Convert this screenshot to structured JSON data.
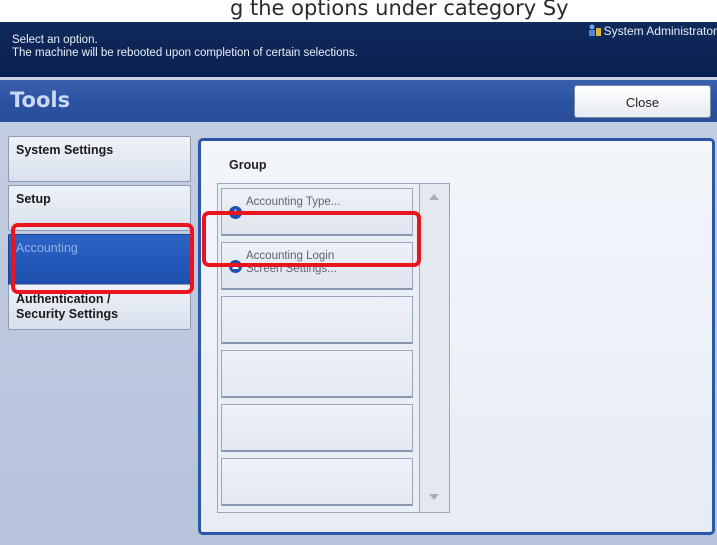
{
  "banner": {
    "text": "g  the  options  under  category  Sy"
  },
  "header": {
    "message_line1": "Select an option.",
    "message_line2": "The machine will be rebooted upon completion of certain selections.",
    "user": "System Administrator",
    "user_icon": "user-admin-icon"
  },
  "titlebar": {
    "title": "Tools",
    "close_label": "Close"
  },
  "tabs": [
    {
      "label": "System Settings",
      "selected": false
    },
    {
      "label": "Setup",
      "selected": false
    },
    {
      "label": "Accounting",
      "selected": true
    },
    {
      "label_line1": "Authentication /",
      "label_line2": "Security Settings",
      "selected": false
    }
  ],
  "group": {
    "label": "Group",
    "items": [
      {
        "line1": "Accounting Type...",
        "line2": "",
        "icon": "circle-arrow-icon"
      },
      {
        "line1": "Accounting Login",
        "line2": "Screen Settings...",
        "icon": "circle-arrow-icon"
      }
    ],
    "empty_slots": 4
  },
  "colors": {
    "header": "#0a2150",
    "titlebar": "#2f56a3",
    "highlight": "#e8141e",
    "selected_tab": "#1d4fae"
  }
}
